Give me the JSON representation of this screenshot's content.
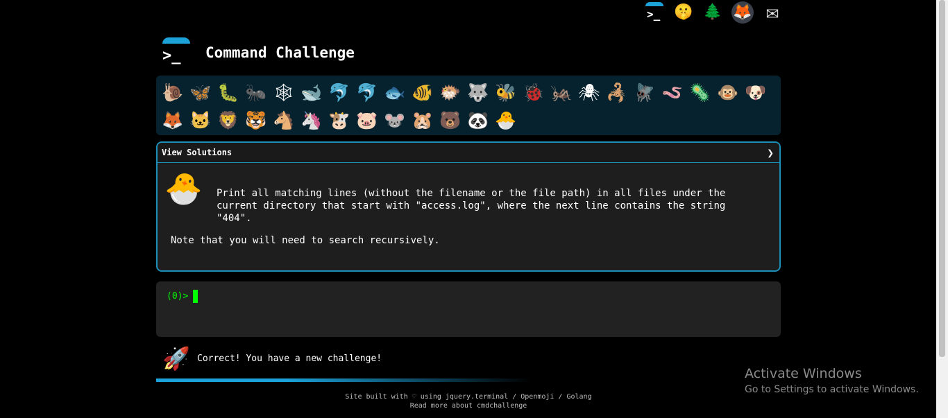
{
  "topbar": {
    "icons": [
      {
        "name": "cmdchallenge-logo-icon",
        "glyph": ">_"
      },
      {
        "name": "shushing-face-icon",
        "glyph": "🤫"
      },
      {
        "name": "tree-icon",
        "glyph": "🌲"
      },
      {
        "name": "gitlab-icon",
        "glyph": "🦊"
      },
      {
        "name": "mail-icon",
        "glyph": "✉"
      }
    ]
  },
  "header": {
    "logo_glyph": ">_",
    "title": "Command Challenge"
  },
  "animals": {
    "items": [
      "🐌",
      "🦋",
      "🐛",
      "🐜",
      "🕸",
      "🐋",
      "🐬",
      "🐬",
      "🐟",
      "🐠",
      "🐡",
      "🐺",
      "🐝",
      "🐞",
      "🦗",
      "🕷",
      "🦂",
      "🪰",
      "🪱",
      "🦠",
      "🐵",
      "🐶",
      "🦊",
      "🐱",
      "🦁",
      "🐯",
      "🐴",
      "🦄",
      "🐮",
      "🐷",
      "🐭",
      "🐹",
      "🐻",
      "🐼",
      "🐣"
    ],
    "current_index": 34
  },
  "challenge": {
    "view_solutions": "View Solutions",
    "chevron": "❯",
    "chick_glyph": "🐣",
    "description": "Print all matching lines (without the filename or the file path) in all files under the current directory that start with \"access.log\", where the next line contains the string \"404\".",
    "note": "Note that you will need to search recursively."
  },
  "terminal": {
    "prompt": "(0)>"
  },
  "status": {
    "rocket_glyph": "🚀",
    "message": "Correct! You have a new challenge!"
  },
  "footer": {
    "line1": "Site built with ♡ using jquery.terminal / Openmoji / Golang",
    "line2": "Read more about cmdchallenge"
  },
  "watermark": {
    "title": "Activate Windows",
    "subtitle": "Go to Settings to activate Windows."
  }
}
